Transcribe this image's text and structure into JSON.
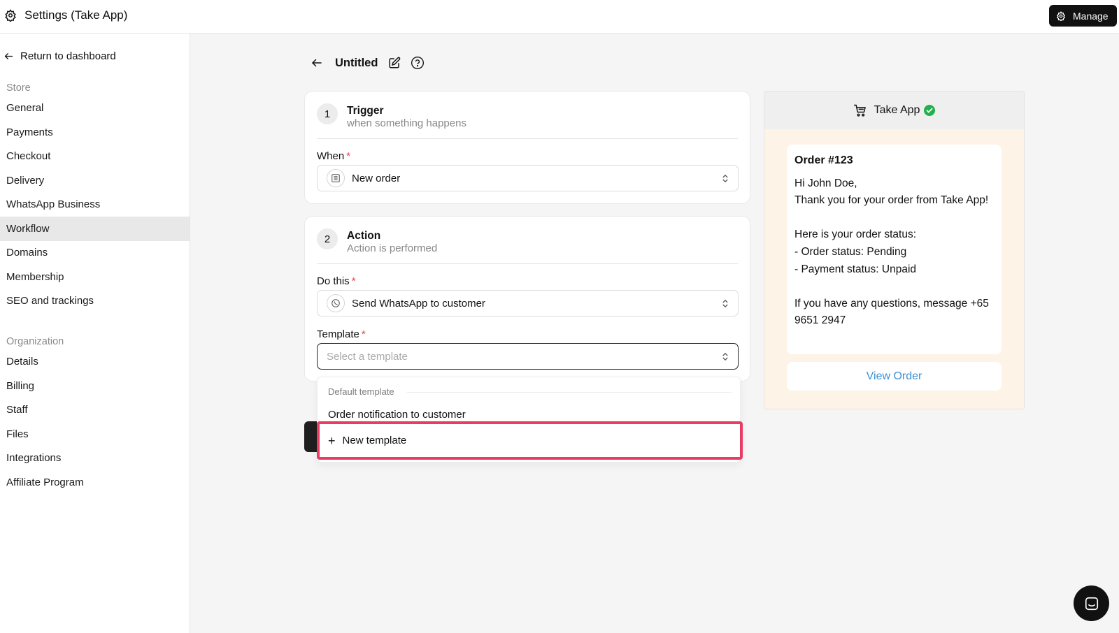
{
  "topbar": {
    "title": "Settings (Take App)",
    "manage_label": "Manage",
    "icon": "gear-icon"
  },
  "sidebar": {
    "back_label": "Return to dashboard",
    "store_section": "Store",
    "store_items": [
      {
        "label": "General"
      },
      {
        "label": "Payments"
      },
      {
        "label": "Checkout"
      },
      {
        "label": "Delivery"
      },
      {
        "label": "WhatsApp Business"
      },
      {
        "label": "Workflow",
        "active": true
      },
      {
        "label": "Domains"
      },
      {
        "label": "Membership"
      },
      {
        "label": "SEO and trackings"
      }
    ],
    "org_section": "Organization",
    "org_items": [
      {
        "label": "Details"
      },
      {
        "label": "Billing"
      },
      {
        "label": "Staff"
      },
      {
        "label": "Files"
      },
      {
        "label": "Integrations"
      },
      {
        "label": "Affiliate Program"
      }
    ]
  },
  "workflow": {
    "title": "Untitled",
    "trigger": {
      "number": "1",
      "title": "Trigger",
      "subtitle": "when something happens",
      "when_label": "When",
      "when_value": "New order"
    },
    "action": {
      "number": "2",
      "title": "Action",
      "subtitle": "Action is performed",
      "do_label": "Do this",
      "do_value": "Send WhatsApp to customer",
      "template_label": "Template",
      "template_placeholder": "Select a template"
    },
    "required_mark": "*"
  },
  "dropdown": {
    "group_label": "Default template",
    "option": "Order notification to customer",
    "new_template": "New template",
    "plus": "+"
  },
  "preview": {
    "app_name": "Take App",
    "order_title": "Order #123",
    "lines": [
      "Hi John Doe,",
      "Thank you for your order from Take App!",
      "",
      "Here is your order status:",
      "- Order status: Pending",
      "- Payment status: Unpaid",
      "",
      "If you have any questions, message +65 9651 2947"
    ],
    "view_button": "View Order"
  },
  "colors": {
    "highlight": "#ea3b64",
    "link": "#3d8fd8",
    "verified": "#22b14c",
    "preview_bg": "#fdf3e7"
  }
}
